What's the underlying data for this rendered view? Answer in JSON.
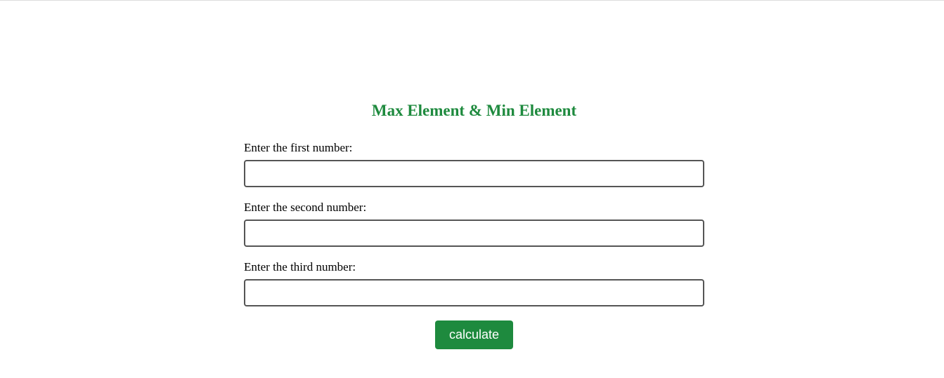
{
  "page": {
    "title": "Max Element & Min Element"
  },
  "form": {
    "fields": [
      {
        "label": "Enter the first number:",
        "value": "",
        "placeholder": ""
      },
      {
        "label": "Enter the second number:",
        "value": "",
        "placeholder": ""
      },
      {
        "label": "Enter the third number:",
        "value": "",
        "placeholder": ""
      }
    ],
    "submit_label": "calculate"
  },
  "colors": {
    "accent": "#1e8a3e",
    "input_border": "#555555",
    "background": "#ffffff"
  }
}
